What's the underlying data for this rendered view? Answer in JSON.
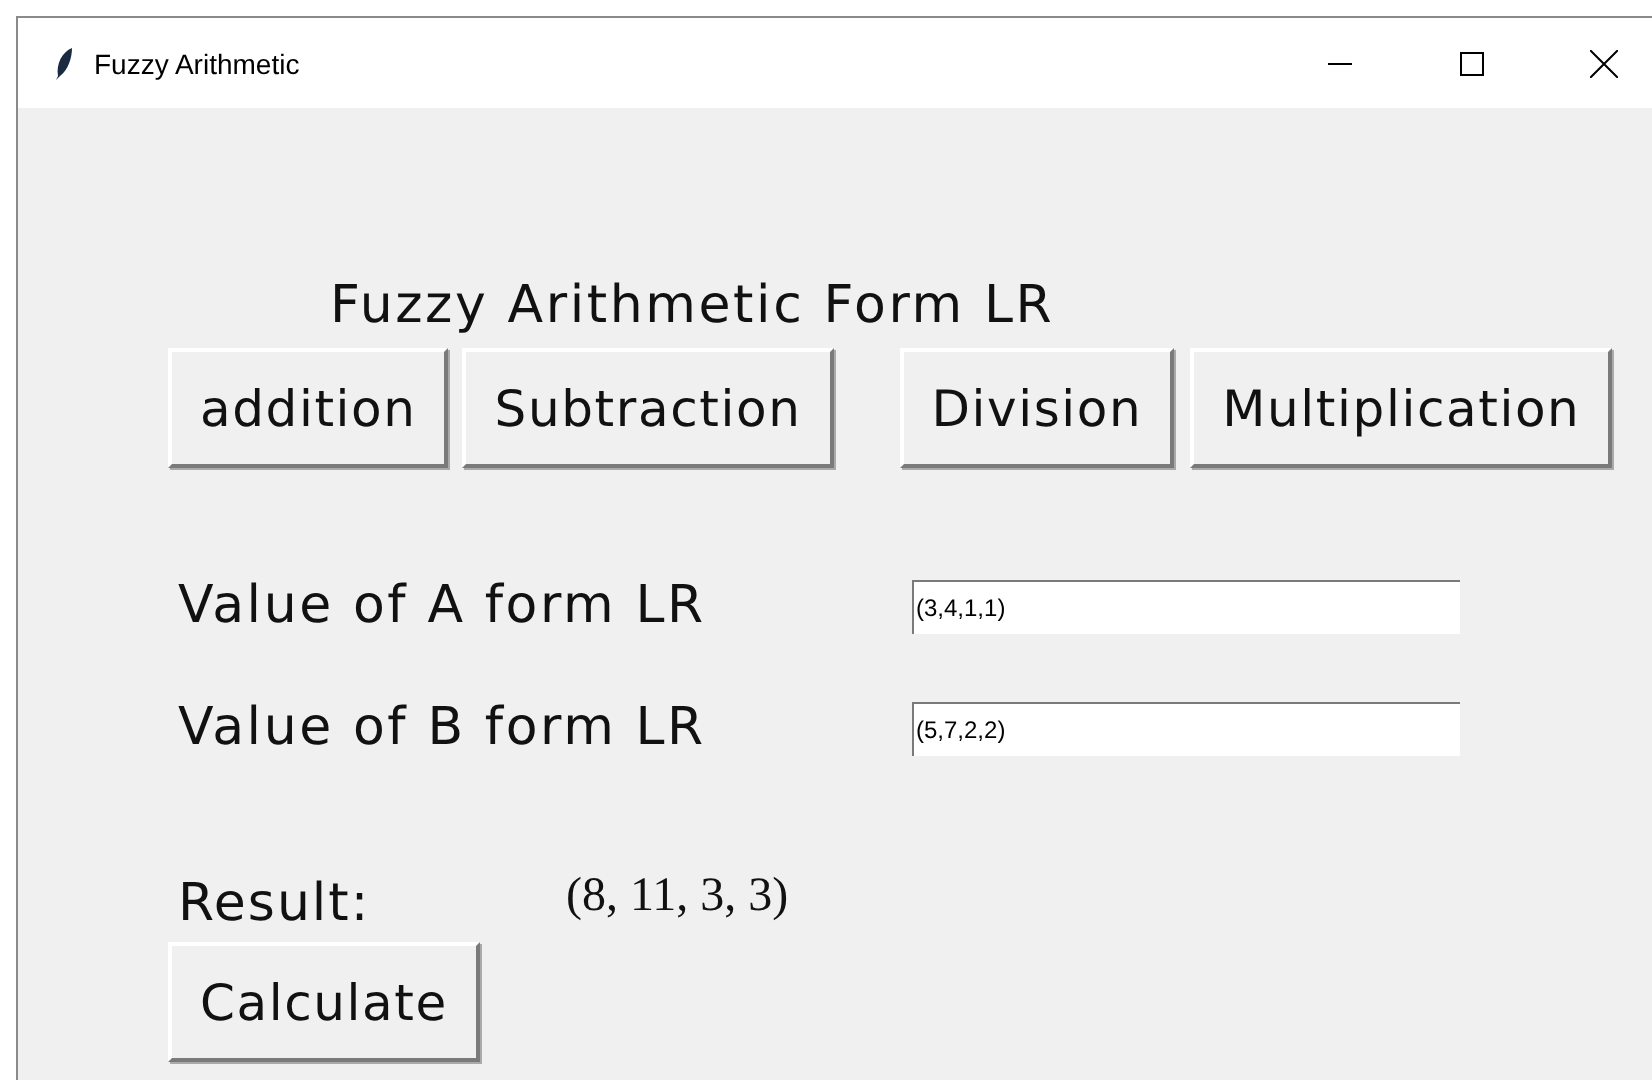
{
  "window": {
    "title": "Fuzzy Arithmetic"
  },
  "heading": "Fuzzy Arithmetic Form LR",
  "operations": [
    {
      "label": "addition"
    },
    {
      "label": "Subtraction"
    },
    {
      "label": "Division"
    },
    {
      "label": "Multiplication"
    }
  ],
  "fields": [
    {
      "label": "Value of A form LR",
      "value": "(3,4,1,1)"
    },
    {
      "label": "Value of B form LR",
      "value": "(5,7,2,2)"
    }
  ],
  "result": {
    "label": "Result:",
    "value": "(8, 11, 3, 3)"
  },
  "calculate_button": "Calculate"
}
